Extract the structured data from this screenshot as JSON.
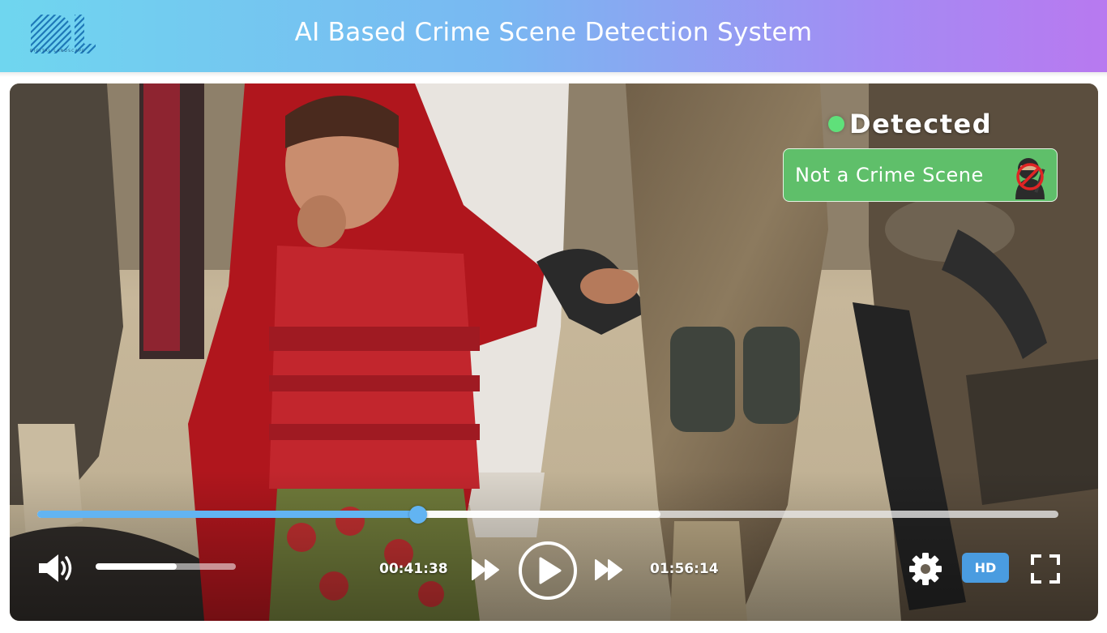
{
  "header": {
    "logo_text": "DIGITAL LANDSCAPE",
    "title": "AI Based Crime Scene Detection System"
  },
  "detection": {
    "status_label": "Detected",
    "status_color": "#5fe07a",
    "result_label": "Not a Crime Scene",
    "result_color": "#5fbf6a",
    "result_icon": "no-weapon-icon"
  },
  "player": {
    "current_time": "00:41:38",
    "duration": "01:56:14",
    "progress_fraction": 0.373,
    "buffered_fraction": 0.61,
    "volume_fraction": 0.58,
    "quality_label": "HD",
    "accent_color": "#62b4f2",
    "icons": {
      "volume": "volume-icon",
      "rewind": "rewind-icon",
      "play": "play-icon",
      "forward": "fast-forward-icon",
      "settings": "gear-icon",
      "fullscreen": "fullscreen-icon"
    }
  }
}
